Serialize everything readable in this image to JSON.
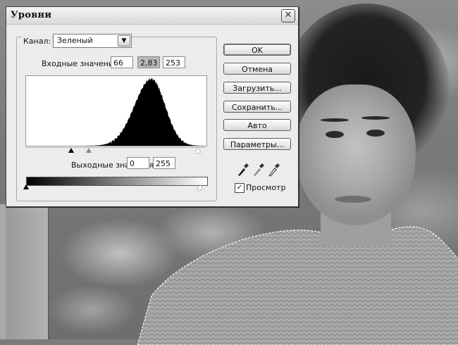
{
  "dialog": {
    "title": "Уровни",
    "channel": {
      "label": "Канал:",
      "value": "Зеленый"
    },
    "input_levels": {
      "label": "Входные значения:",
      "black": "66",
      "gamma": "2,83",
      "white": "253"
    },
    "output_levels": {
      "label": "Выходные значения:",
      "black": "0",
      "white": "255"
    },
    "buttons": {
      "ok": "OK",
      "cancel": "Отмена",
      "load": "Загрузить...",
      "save": "Сохранить...",
      "auto": "Авто",
      "options": "Параметры..."
    },
    "preview": {
      "label": "Просмотр",
      "checked": true
    },
    "icons": [
      "close-icon",
      "dropdown-arrow-icon",
      "black-eyedropper-icon",
      "gray-eyedropper-icon",
      "white-eyedropper-icon",
      "checkmark-icon"
    ],
    "histogram": {
      "peak_level": 178,
      "spread": 24
    }
  }
}
